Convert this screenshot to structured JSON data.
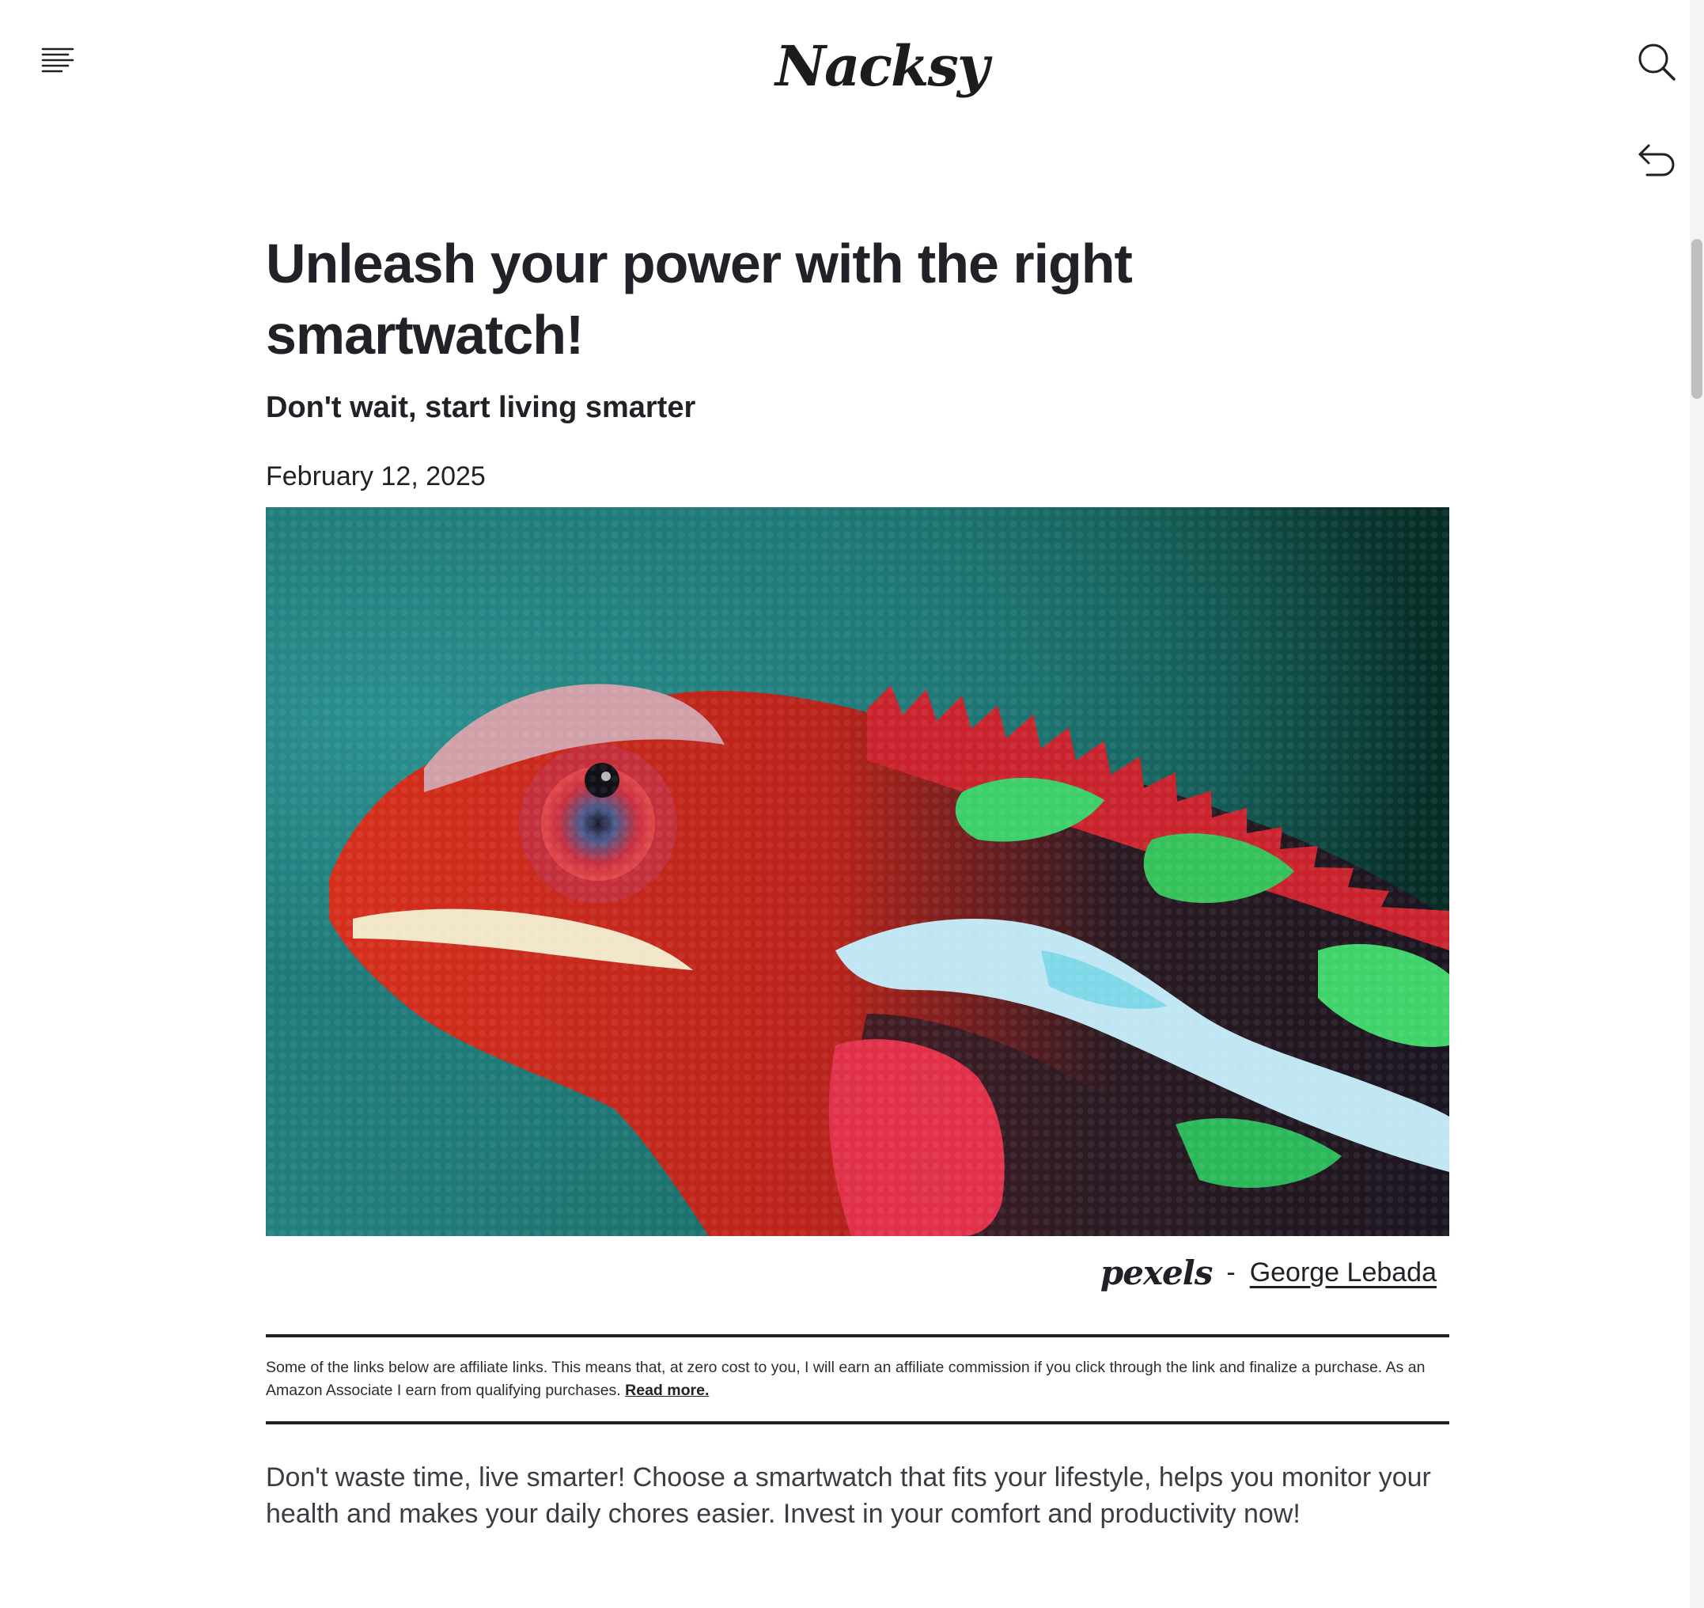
{
  "header": {
    "logo": "Nacksy",
    "menu_icon": "hamburger-menu-icon",
    "search_icon": "search-icon",
    "back_icon": "undo-arrow-icon"
  },
  "article": {
    "title": "Unleash your power with the right smartwatch!",
    "subtitle": "Don't wait, start living smarter",
    "date": "February 12, 2025",
    "image": {
      "subject": "chameleon",
      "credit_source": "pexels",
      "credit_separator": "-",
      "credit_author": "George Lebada"
    },
    "disclaimer": {
      "text": "Some of the links below are affiliate links. This means that, at zero cost to you, I will earn an affiliate commission if you click through the link and finalize a purchase. As an Amazon Associate I earn from qualifying purchases.",
      "link": "Read more."
    },
    "intro": "Don't waste time, live smarter! Choose a smartwatch that fits your lifestyle, helps you monitor your health and makes your daily chores easier. Invest in your comfort and productivity now!"
  },
  "colors": {
    "text": "#202227",
    "background": "#ffffff",
    "hero_teal": "#1f7a79"
  }
}
